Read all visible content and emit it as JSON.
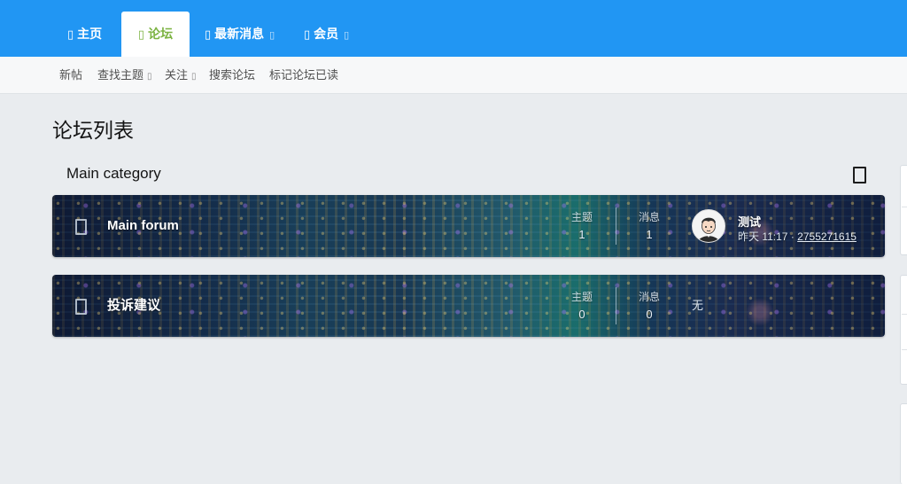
{
  "nav": {
    "tabs": [
      {
        "label": "主页",
        "icon": "home-icon",
        "glyph": "▯",
        "has_menu": false,
        "active": false
      },
      {
        "label": "论坛",
        "icon": "comments-icon",
        "glyph": "▯",
        "has_menu": false,
        "active": true
      },
      {
        "label": "最新消息",
        "icon": "bolt-icon",
        "glyph": "▯",
        "has_menu": true,
        "active": false
      },
      {
        "label": "会员",
        "icon": "users-icon",
        "glyph": "▯",
        "has_menu": true,
        "active": false
      }
    ],
    "menu_caret": "▯"
  },
  "subnav": {
    "items": [
      {
        "label": "新帖",
        "has_menu": false
      },
      {
        "label": "查找主题",
        "has_menu": true
      },
      {
        "label": "关注",
        "has_menu": true
      },
      {
        "label": "搜索论坛",
        "has_menu": false
      },
      {
        "label": "标记论坛已读",
        "has_menu": false
      }
    ]
  },
  "page": {
    "title": "论坛列表"
  },
  "category": {
    "title": "Main category",
    "forums": [
      {
        "name": "Main forum",
        "threads_label": "主题",
        "threads": "1",
        "messages_label": "消息",
        "messages": "1",
        "last_post": {
          "title": "测试",
          "time": "昨天 11:17",
          "separator": "·",
          "user": "2755271615"
        }
      },
      {
        "name": "投诉建议",
        "threads_label": "主题",
        "threads": "0",
        "messages_label": "消息",
        "messages": "0",
        "last_post_none": "无"
      }
    ]
  },
  "colors": {
    "accent": "#2196f3",
    "active_tab_text": "#7cb342",
    "background": "#e9ecef"
  }
}
